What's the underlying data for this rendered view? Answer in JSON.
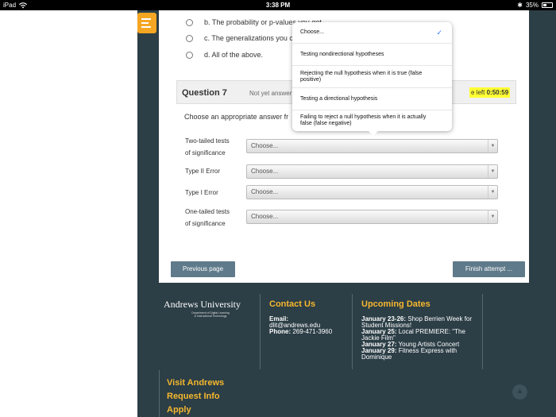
{
  "statusbar": {
    "device": "iPad",
    "time": "3:38 PM",
    "battery": "35%"
  },
  "options": {
    "b": "b. The probability or p-values you get",
    "c": "c. The generalizations you c",
    "d": "d. All of the above."
  },
  "question": {
    "title": "Question 7",
    "status": "Not yet answer",
    "timer_prefix": "e left",
    "timer_value": "0:50:59",
    "prompt": "Choose an appropriate answer fr"
  },
  "match_rows": [
    {
      "label_line1": "Two-tailed tests",
      "label_line2": "of significance",
      "value": "Choose..."
    },
    {
      "label_line1": "Type II Error",
      "label_line2": "",
      "value": "Choose..."
    },
    {
      "label_line1": "Type I Error",
      "label_line2": "",
      "value": "Choose..."
    },
    {
      "label_line1": "One-tailed tests",
      "label_line2": "of significance",
      "value": "Choose..."
    }
  ],
  "dropdown": {
    "items": [
      {
        "text": "Choose...",
        "selected": true
      },
      {
        "text": "Testing nondirectional hypotheses"
      },
      {
        "text": "Rejecting the null hypothesis when it is true (false positive)"
      },
      {
        "text": "Testing a directional hypothesis"
      },
      {
        "text": "Failing to reject a null hypothesis when it is actually false (false negative)"
      }
    ]
  },
  "nav": {
    "previous": "Previous page",
    "finish": "Finish attempt ..."
  },
  "footer": {
    "logo": "Andrews University",
    "logo_sub1": "Department of Digital Learning",
    "logo_sub2": "& Instructional Technology",
    "contact_heading": "Contact Us",
    "email_label": "Email:",
    "email": "dlit@andrews.edu",
    "phone_label": "Phone:",
    "phone": "269-471-3960",
    "dates_heading": "Upcoming Dates",
    "events": [
      {
        "date": "January 23-26:",
        "text": "Shop Berrien Week for Student Missions!"
      },
      {
        "date": "January 25:",
        "text": "Local PREMIERE: \"The Jackie Film\""
      },
      {
        "date": "January 27:",
        "text": "Young Artists Concert"
      },
      {
        "date": "January 29:",
        "text": "Fitness Express with Dominique"
      }
    ],
    "links": [
      "Visit Andrews",
      "Request Info",
      "Apply"
    ]
  },
  "colors": {
    "accent": "#f5b82e",
    "footer_bg": "#2c3e46",
    "button": "#5f7a8a",
    "timer_highlight": "#ffff33"
  }
}
